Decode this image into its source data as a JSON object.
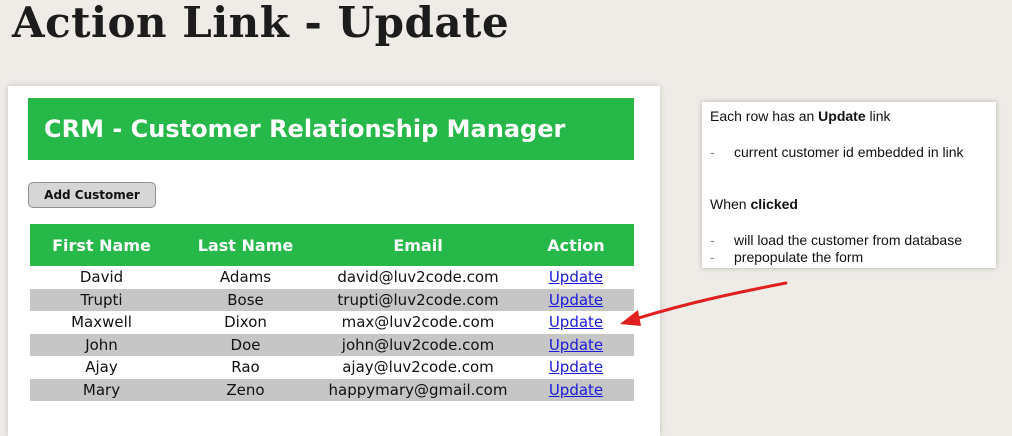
{
  "slide": {
    "title": "Action Link - Update"
  },
  "app": {
    "header": "CRM - Customer Relationship Manager",
    "add_button": "Add Customer",
    "table": {
      "columns": [
        "First Name",
        "Last Name",
        "Email",
        "Action"
      ],
      "rows": [
        {
          "first": "David",
          "last": "Adams",
          "email": "david@luv2code.com",
          "action": "Update"
        },
        {
          "first": "Trupti",
          "last": "Bose",
          "email": "trupti@luv2code.com",
          "action": "Update"
        },
        {
          "first": "Maxwell",
          "last": "Dixon",
          "email": "max@luv2code.com",
          "action": "Update"
        },
        {
          "first": "John",
          "last": "Doe",
          "email": "john@luv2code.com",
          "action": "Update"
        },
        {
          "first": "Ajay",
          "last": "Rao",
          "email": "ajay@luv2code.com",
          "action": "Update"
        },
        {
          "first": "Mary",
          "last": "Zeno",
          "email": "happymary@gmail.com",
          "action": "Update"
        }
      ]
    }
  },
  "notes": {
    "line1_prefix": "Each row has an ",
    "line1_bold": "Update",
    "line1_suffix": " link",
    "bullet1": "current customer id embedded in link",
    "line2_prefix": "When ",
    "line2_bold": "clicked",
    "bullet2": "will load the customer from database",
    "bullet3": "prepopulate the form",
    "dash": "-"
  },
  "colors": {
    "accent_green": "#27b84a",
    "link_blue": "#1a1adb",
    "arrow_red": "#e0201e",
    "row_stripe": "#c6c6c6"
  }
}
